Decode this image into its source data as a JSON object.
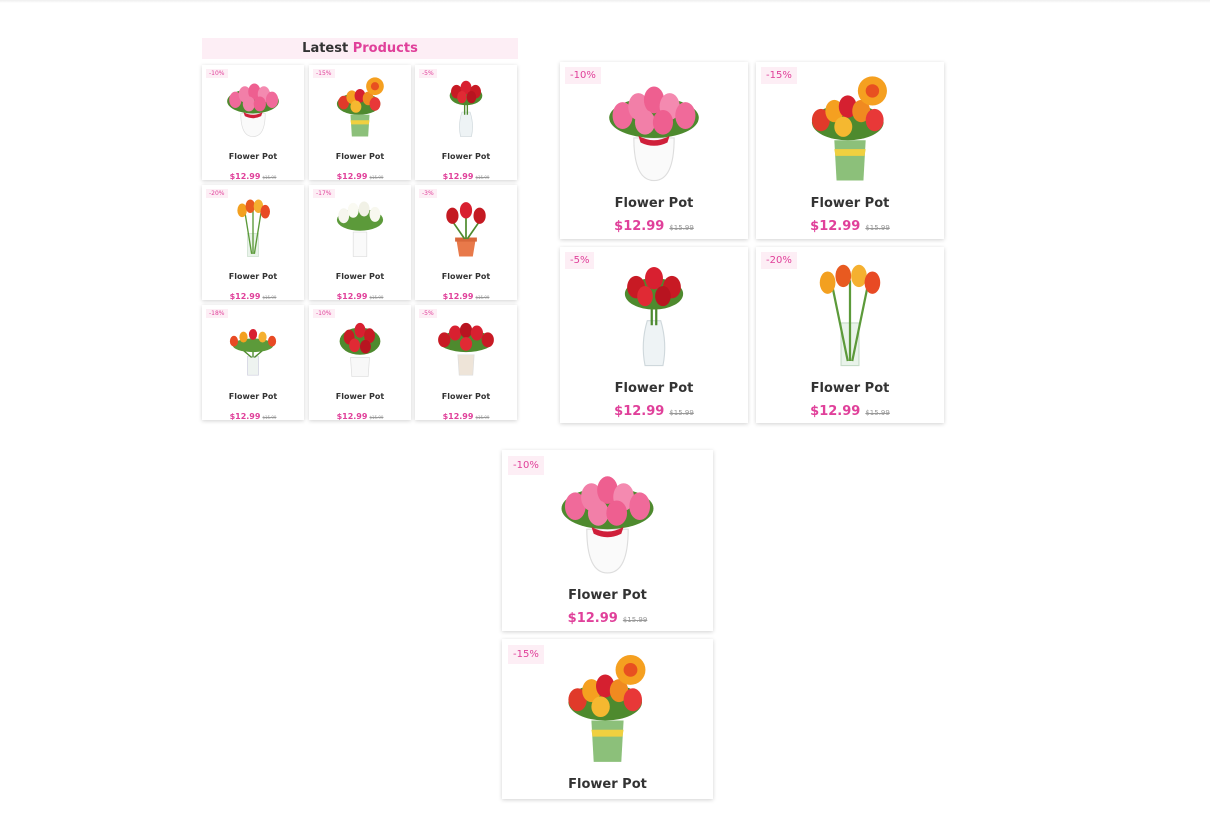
{
  "header": {
    "title_plain": "Latest",
    "title_accent": "Products"
  },
  "colors": {
    "accent": "#e0409a",
    "badge_bg": "#fdeef5"
  },
  "small_grid": [
    {
      "discount": "-10%",
      "name": "Flower Pot",
      "price": "$12.99",
      "old_price": "$15.99",
      "image": "pink-tulips-white-vase"
    },
    {
      "discount": "-15%",
      "name": "Flower Pot",
      "price": "$12.99",
      "old_price": "$15.99",
      "image": "mixed-tulips-green-pot"
    },
    {
      "discount": "-5%",
      "name": "Flower Pot",
      "price": "$12.99",
      "old_price": "$15.99",
      "image": "red-tulips-glass-vase"
    },
    {
      "discount": "-20%",
      "name": "Flower Pot",
      "price": "$12.99",
      "old_price": "$15.99",
      "image": "orange-tulips-glass-vase"
    },
    {
      "discount": "-17%",
      "name": "Flower Pot",
      "price": "$12.99",
      "old_price": "$15.99",
      "image": "white-tulips-white-vase"
    },
    {
      "discount": "-3%",
      "name": "Flower Pot",
      "price": "$12.99",
      "old_price": "$15.99",
      "image": "red-tulips-clay-pot"
    },
    {
      "discount": "-18%",
      "name": "Flower Pot",
      "price": "$12.99",
      "old_price": "$15.99",
      "image": "spread-tulips-small-vase"
    },
    {
      "discount": "-10%",
      "name": "Flower Pot",
      "price": "$12.99",
      "old_price": "$15.99",
      "image": "red-tulips-white-bucket"
    },
    {
      "discount": "-5%",
      "name": "Flower Pot",
      "price": "$12.99",
      "old_price": "$15.99",
      "image": "red-tulips-cream-pot"
    }
  ],
  "medium_grid": [
    {
      "discount": "-10%",
      "name": "Flower Pot",
      "price": "$12.99",
      "old_price": "$15.99",
      "image": "pink-tulips-white-vase"
    },
    {
      "discount": "-15%",
      "name": "Flower Pot",
      "price": "$12.99",
      "old_price": "$15.99",
      "image": "mixed-tulips-green-pot"
    },
    {
      "discount": "-5%",
      "name": "Flower Pot",
      "price": "$12.99",
      "old_price": "$15.99",
      "image": "red-tulips-glass-vase"
    },
    {
      "discount": "-20%",
      "name": "Flower Pot",
      "price": "$12.99",
      "old_price": "$15.99",
      "image": "orange-tulips-glass-vase"
    }
  ],
  "large_list": [
    {
      "discount": "-10%",
      "name": "Flower Pot",
      "price": "$12.99",
      "old_price": "$15.99",
      "image": "pink-tulips-white-vase"
    },
    {
      "discount": "-15%",
      "name": "Flower Pot",
      "image": "mixed-tulips-green-pot"
    }
  ]
}
